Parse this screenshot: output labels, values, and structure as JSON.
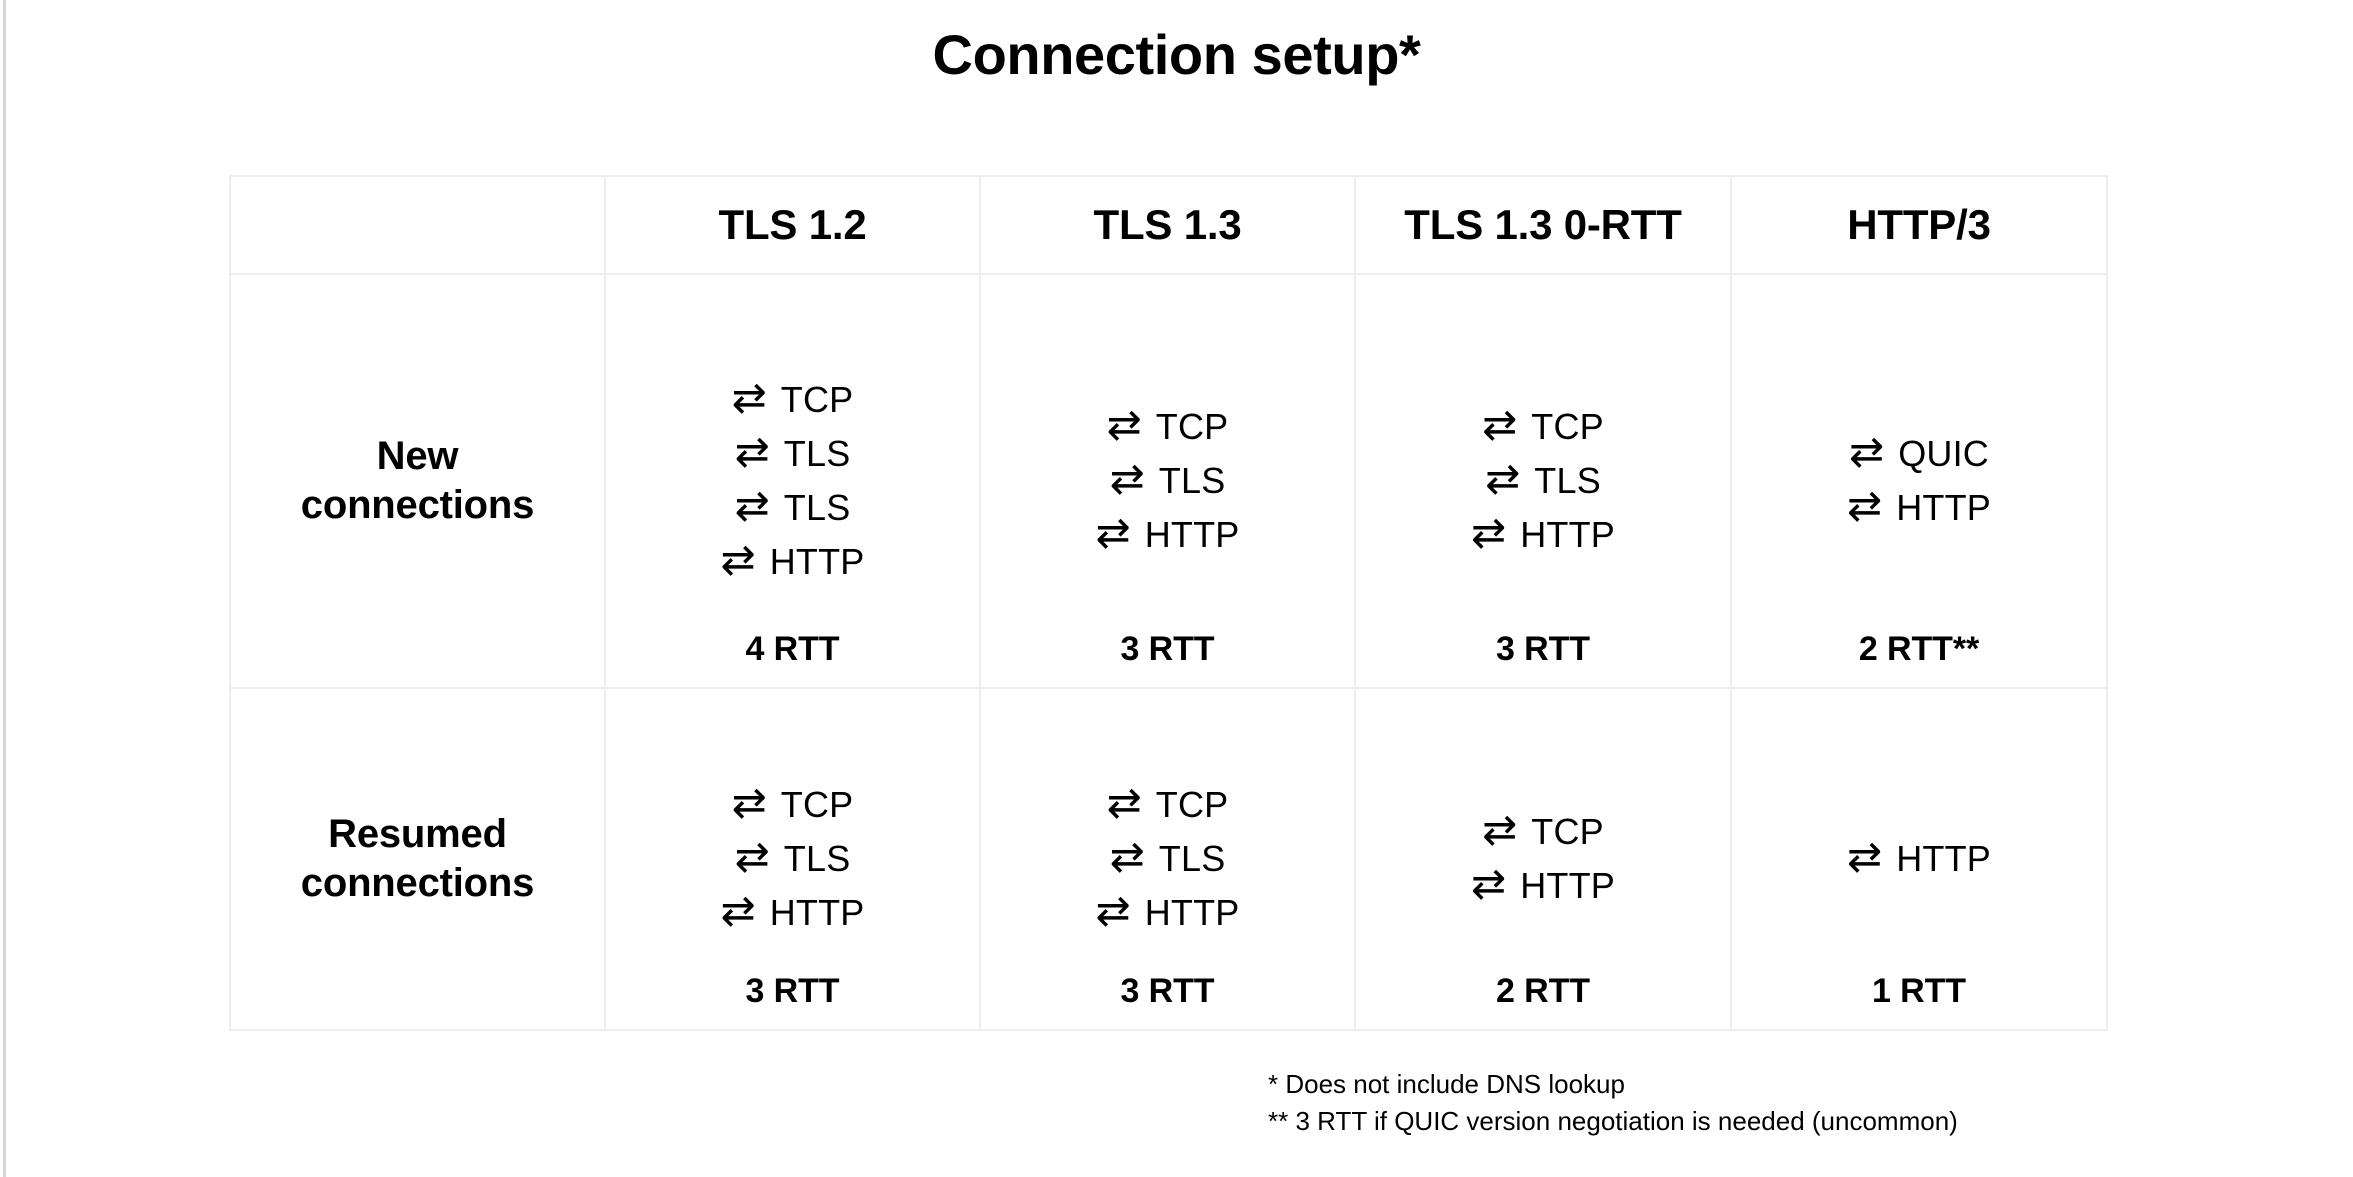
{
  "slide": {
    "title": "Connection setup*"
  },
  "table": {
    "corner_header": "",
    "columns": [
      "TLS 1.2",
      "TLS 1.3",
      "TLS 1.3 0-RTT",
      "HTTP/3"
    ],
    "arrow_icon": "⇄",
    "rows": [
      {
        "label_line1": "New",
        "label_line2": "connections",
        "cells": [
          {
            "steps": [
              "TCP",
              "TLS",
              "TLS",
              "HTTP"
            ],
            "rtt": "4 RTT"
          },
          {
            "steps": [
              "TCP",
              "TLS",
              "HTTP"
            ],
            "rtt": "3 RTT"
          },
          {
            "steps": [
              "TCP",
              "TLS",
              "HTTP"
            ],
            "rtt": "3 RTT"
          },
          {
            "steps": [
              "QUIC",
              "HTTP"
            ],
            "rtt": "2 RTT**"
          }
        ]
      },
      {
        "label_line1": "Resumed",
        "label_line2": "connections",
        "cells": [
          {
            "steps": [
              "TCP",
              "TLS",
              "HTTP"
            ],
            "rtt": "3 RTT"
          },
          {
            "steps": [
              "TCP",
              "TLS",
              "HTTP"
            ],
            "rtt": "3 RTT"
          },
          {
            "steps": [
              "TCP",
              "HTTP"
            ],
            "rtt": "2 RTT"
          },
          {
            "steps": [
              "HTTP"
            ],
            "rtt": "1 RTT"
          }
        ]
      }
    ]
  },
  "footnotes": [
    "* Does not include DNS lookup",
    "** 3 RTT if QUIC version negotiation is needed (uncommon)"
  ],
  "colors": {
    "background": "#ffffff",
    "text": "#000000",
    "table_border": "#ededee",
    "slide_edge": "#d4d6d8"
  }
}
